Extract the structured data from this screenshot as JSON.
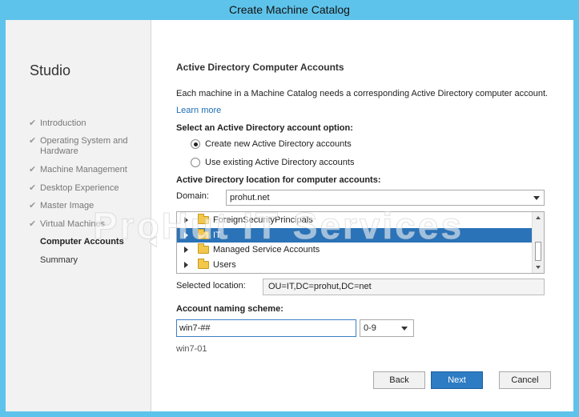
{
  "window": {
    "title": "Create Machine Catalog"
  },
  "sidebar": {
    "title": "Studio",
    "steps": [
      {
        "label": "Introduction",
        "checked": true
      },
      {
        "label": "Operating System and",
        "label2": "Hardware",
        "checked": true
      },
      {
        "label": "Machine Management",
        "checked": true
      },
      {
        "label": "Desktop Experience",
        "checked": true
      },
      {
        "label": "Master Image",
        "checked": true
      },
      {
        "label": "Virtual Machines",
        "checked": true
      },
      {
        "label": "Computer Accounts",
        "active": true
      },
      {
        "label": "Summary"
      }
    ],
    "check_glyph": "✔"
  },
  "main": {
    "heading": "Active Directory Computer Accounts",
    "description": "Each machine in a Machine Catalog needs a corresponding Active Directory computer account.",
    "learn_more": "Learn more",
    "option_label": "Select an Active Directory account option:",
    "options": [
      {
        "label": "Create new Active Directory accounts",
        "selected": true
      },
      {
        "label": "Use existing Active Directory accounts",
        "selected": false
      }
    ],
    "location_label": "Active Directory location for computer accounts:",
    "domain_label": "Domain:",
    "domain_value": "prohut.net",
    "tree": [
      {
        "label": "ForeignSecurityPrincipals"
      },
      {
        "label": "IT",
        "selected": true
      },
      {
        "label": "Managed Service Accounts"
      },
      {
        "label": "Users"
      }
    ],
    "selected_location_label": "Selected location:",
    "selected_location_value": "OU=IT,DC=prohut,DC=net",
    "naming_label": "Account naming scheme:",
    "naming_value": "win7-##",
    "naming_type": "0-9",
    "naming_preview": "win7-01"
  },
  "buttons": {
    "back": "Back",
    "next": "Next",
    "cancel": "Cancel"
  },
  "watermark": "ProHut IT Services",
  "colors": {
    "title_bar": "#5ec3ea",
    "selection": "#2a73b8",
    "primary_button": "#2d7cc4",
    "link": "#1f6fb5"
  }
}
